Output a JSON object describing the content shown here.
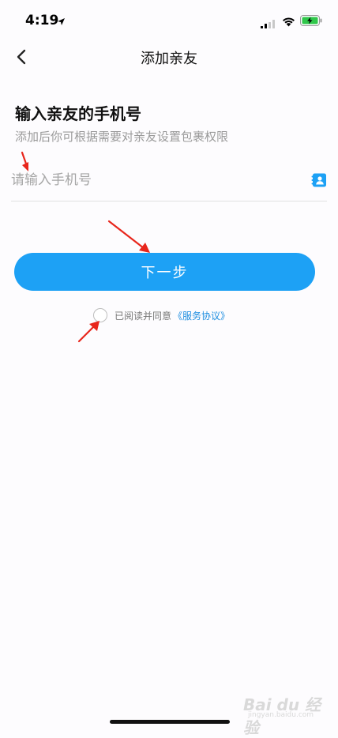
{
  "status_bar": {
    "time": "4:19"
  },
  "nav": {
    "title": "添加亲友"
  },
  "form": {
    "heading": "输入亲友的手机号",
    "subheading": "添加后你可根据需要对亲友设置包裹权限",
    "phone_placeholder": "请输入手机号",
    "next_label": "下一步",
    "agree_text": "已阅读并同意",
    "agree_link": "《服务协议》"
  },
  "watermark": {
    "logo": "Bai du 经验",
    "sub": "jingyan.baidu.com"
  },
  "colors": {
    "accent": "#1da1f5",
    "link": "#1e8ee0",
    "annotation_arrow": "#e8261c",
    "background": "#fdfcfe"
  }
}
